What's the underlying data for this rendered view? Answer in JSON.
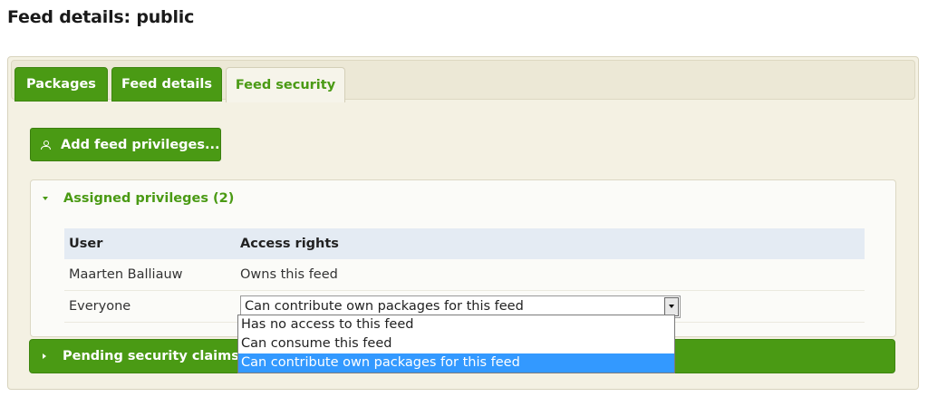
{
  "page": {
    "title": "Feed details: public"
  },
  "tabs": [
    {
      "label": "Packages"
    },
    {
      "label": "Feed details"
    },
    {
      "label": "Feed security"
    }
  ],
  "add_button": {
    "label": "Add feed privileges..."
  },
  "assigned": {
    "header": "Assigned privileges (2)",
    "columns": [
      "User",
      "Access rights"
    ],
    "rows": [
      {
        "user": "Maarten Balliauw",
        "rights": "Owns this feed"
      },
      {
        "user": "Everyone",
        "rights": "Can contribute own packages for this feed"
      }
    ]
  },
  "dropdown": {
    "options": [
      "Has no access to this feed",
      "Can consume this feed",
      "Can contribute own packages for this feed"
    ],
    "selected_index": 2
  },
  "pending": {
    "header": "Pending security claims (1)"
  },
  "colors": {
    "accent": "#4a9a14",
    "selection": "#3399ff",
    "panel": "#f4f1e3"
  }
}
